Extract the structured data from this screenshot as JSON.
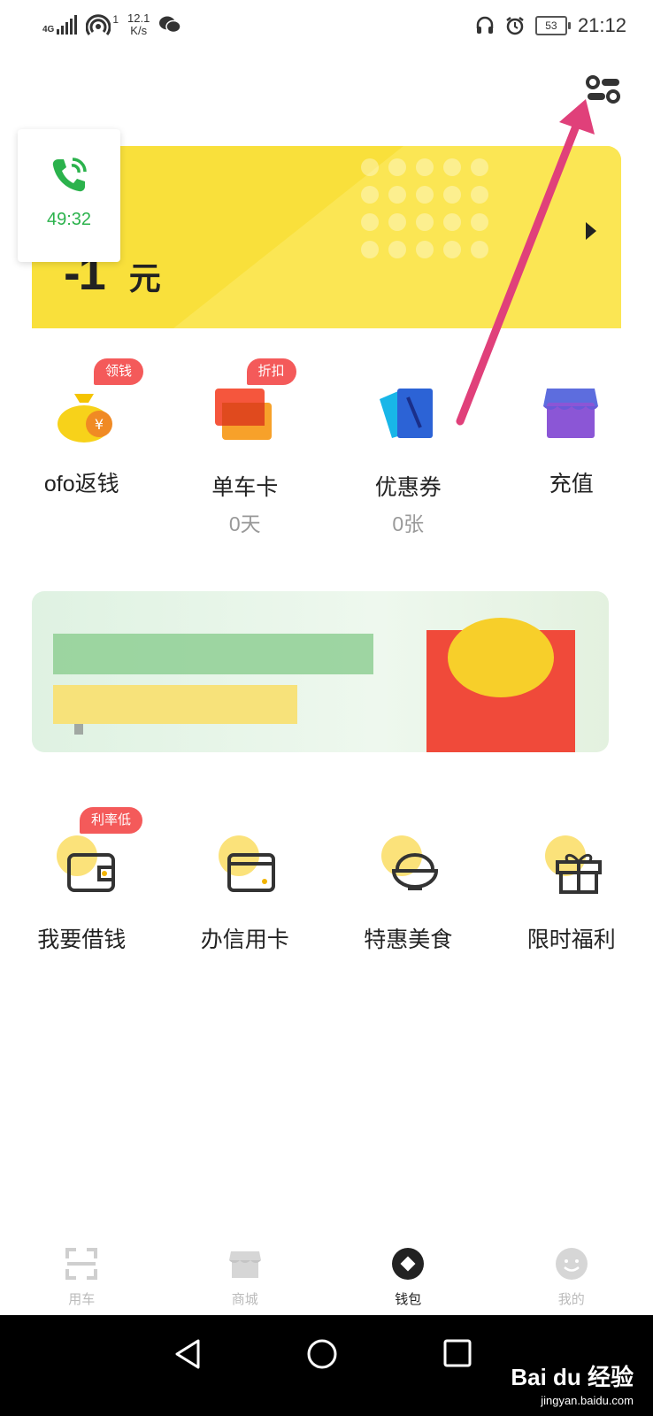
{
  "status_bar": {
    "network": "4G",
    "hotspot_count": "1",
    "speed_value": "12.1",
    "speed_unit": "K/s",
    "battery": "53",
    "time": "21:12"
  },
  "wallet": {
    "balance_visible": "-1",
    "balance_unit": "元"
  },
  "call_window": {
    "duration": "49:32"
  },
  "quick_items": [
    {
      "label": "ofo返钱",
      "tag": "领钱",
      "icon": "money-bag-icon"
    },
    {
      "label": "单车卡",
      "sub": "0天",
      "tag": "折扣",
      "icon": "bike-card-icon"
    },
    {
      "label": "优惠券",
      "sub": "0张",
      "icon": "coupon-icon"
    },
    {
      "label": "充值",
      "icon": "shop-recharge-icon"
    }
  ],
  "services": [
    {
      "label": "我要借钱",
      "tag": "利率低",
      "icon": "wallet-icon"
    },
    {
      "label": "办信用卡",
      "icon": "credit-card-icon"
    },
    {
      "label": "特惠美食",
      "icon": "rice-bowl-icon"
    },
    {
      "label": "限时福利",
      "icon": "gift-icon"
    }
  ],
  "tabs": [
    {
      "label": "用车",
      "icon": "scan-icon",
      "active": false
    },
    {
      "label": "商城",
      "icon": "store-icon",
      "active": false
    },
    {
      "label": "钱包",
      "icon": "wallet-tab-icon",
      "active": true
    },
    {
      "label": "我的",
      "icon": "profile-face-icon",
      "active": false
    }
  ],
  "watermark": {
    "brand": "Bai du 经验",
    "url": "jingyan.baidu.com"
  },
  "colors": {
    "card_yellow": "#f9e03b",
    "tag_red": "#f45a5a",
    "annotation_arrow": "#e0407a",
    "call_green": "#2bb24c"
  }
}
